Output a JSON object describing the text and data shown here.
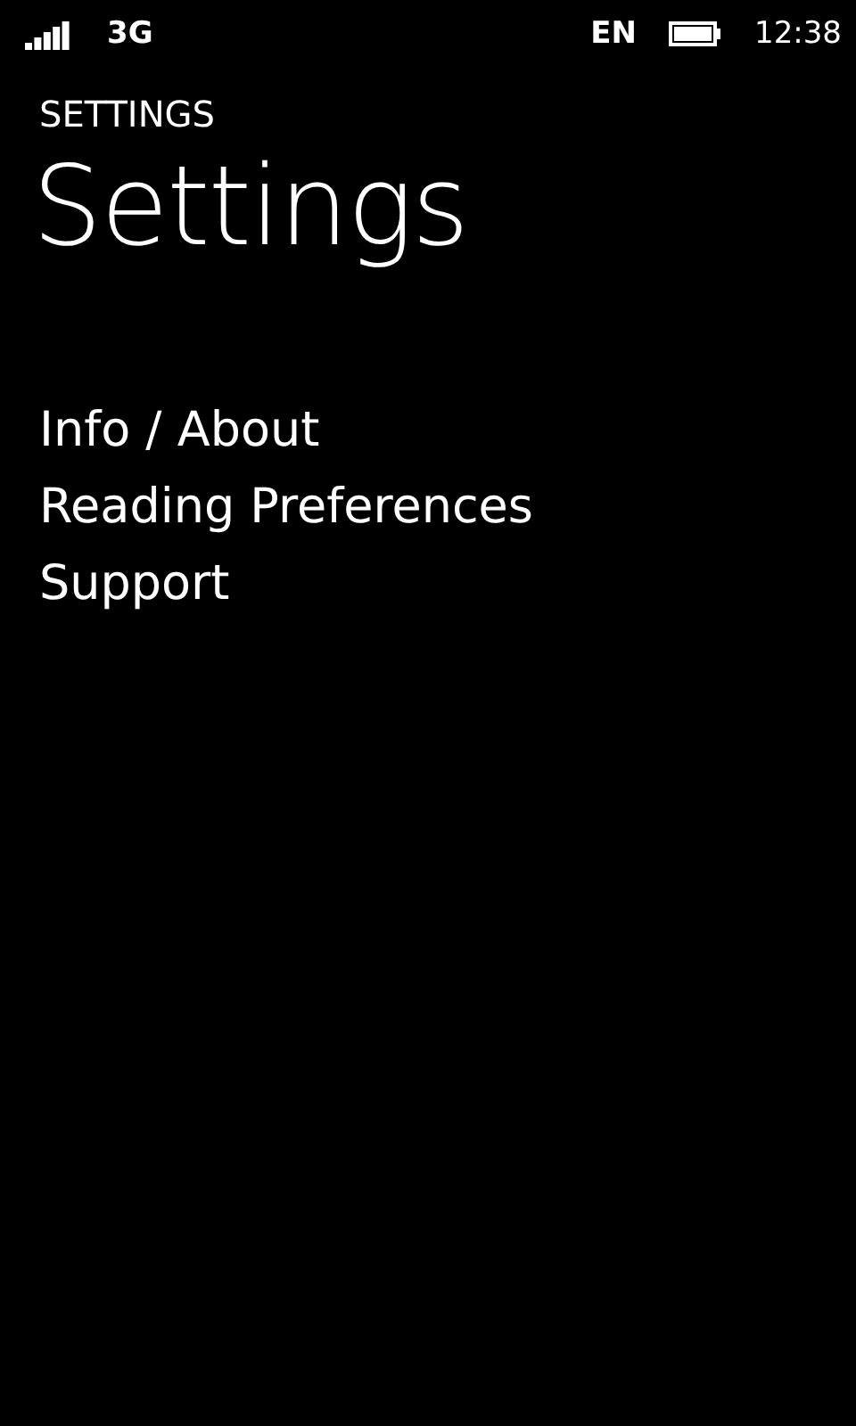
{
  "status_bar": {
    "network": "3G",
    "language": "EN",
    "time": "12:38"
  },
  "app_title": "SETTINGS",
  "page_title": "Settings",
  "items": [
    {
      "label": "Info / About"
    },
    {
      "label": "Reading Preferences"
    },
    {
      "label": "Support"
    }
  ]
}
